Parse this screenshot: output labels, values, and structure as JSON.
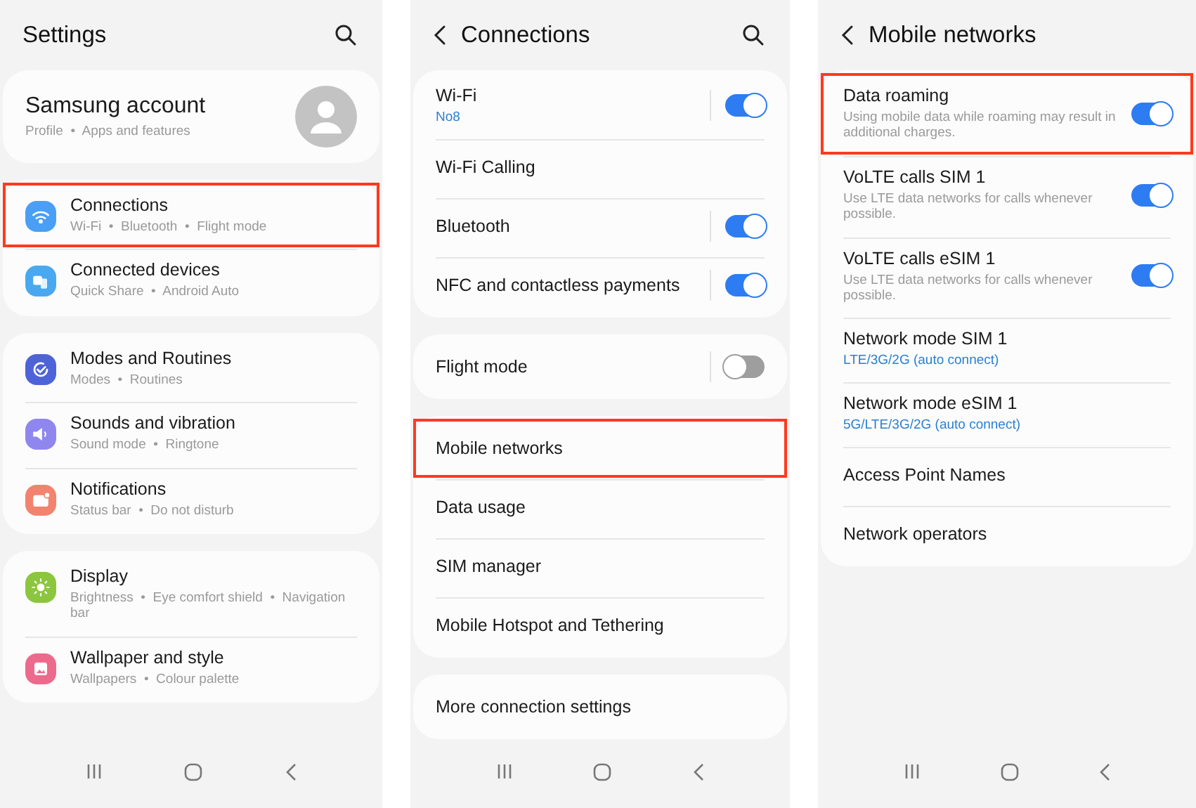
{
  "screens": [
    {
      "title": "Settings",
      "back_button": false,
      "search_button": true,
      "groups": [
        {
          "items": [
            {
              "kind": "account",
              "title": "Samsung account",
              "subtitle": "Profile  •  Apps and features",
              "highlighted": false
            }
          ]
        },
        {
          "items": [
            {
              "kind": "link",
              "title": "Connections",
              "subtitle": "Wi-Fi  •  Bluetooth  •  Flight mode",
              "color": "#4a9ff5",
              "highlighted": true
            },
            {
              "kind": "link",
              "title": "Connected devices",
              "subtitle": "Quick Share  •  Android Auto",
              "color": "#4aa8f0",
              "highlighted": false
            }
          ]
        },
        {
          "items": [
            {
              "kind": "link",
              "title": "Modes and Routines",
              "subtitle": "Modes  •  Routines",
              "color": "#4e63d8",
              "highlighted": false
            },
            {
              "kind": "link",
              "title": "Sounds and vibration",
              "subtitle": "Sound mode  •  Ringtone",
              "color": "#8f87ee",
              "highlighted": false
            },
            {
              "kind": "link",
              "title": "Notifications",
              "subtitle": "Status bar  •  Do not disturb",
              "color": "#f2836f",
              "highlighted": false
            }
          ]
        },
        {
          "items": [
            {
              "kind": "link",
              "title": "Display",
              "subtitle": "Brightness  •  Eye comfort shield  •  Navigation bar",
              "color": "#8cc63f",
              "highlighted": false
            },
            {
              "kind": "link",
              "title": "Wallpaper and style",
              "subtitle": "Wallpapers  •  Colour palette",
              "color": "#ec6b8d",
              "highlighted": false
            }
          ]
        }
      ]
    },
    {
      "title": "Connections",
      "back_button": true,
      "search_button": true,
      "groups": [
        {
          "items": [
            {
              "kind": "split_toggle",
              "title": "Wi-Fi",
              "value": "No8",
              "on": true,
              "highlighted": false
            },
            {
              "kind": "link",
              "title": "Wi-Fi Calling",
              "highlighted": false
            },
            {
              "kind": "split_toggle",
              "title": "Bluetooth",
              "on": true,
              "highlighted": false
            },
            {
              "kind": "split_toggle",
              "title": "NFC and contactless payments",
              "on": true,
              "highlighted": false
            }
          ]
        },
        {
          "items": [
            {
              "kind": "split_toggle",
              "title": "Flight mode",
              "on": false,
              "highlighted": false
            }
          ]
        },
        {
          "items": [
            {
              "kind": "link",
              "title": "Mobile networks",
              "highlighted": true
            },
            {
              "kind": "link",
              "title": "Data usage",
              "highlighted": false
            },
            {
              "kind": "link",
              "title": "SIM manager",
              "highlighted": false
            },
            {
              "kind": "link",
              "title": "Mobile Hotspot and Tethering",
              "highlighted": false
            }
          ]
        },
        {
          "items": [
            {
              "kind": "link",
              "title": "More connection settings",
              "highlighted": false
            }
          ]
        }
      ]
    },
    {
      "title": "Mobile networks",
      "back_button": true,
      "search_button": false,
      "groups": [
        {
          "items": [
            {
              "kind": "toggle",
              "title": "Data roaming",
              "subtitle": "Using mobile data while roaming may result in additional charges.",
              "on": true,
              "highlighted": true
            },
            {
              "kind": "toggle",
              "title": "VoLTE calls SIM 1",
              "subtitle": "Use LTE data networks for calls whenever possible.",
              "on": true,
              "highlighted": false
            },
            {
              "kind": "toggle",
              "title": "VoLTE calls eSIM 1",
              "subtitle": "Use LTE data networks for calls whenever possible.",
              "on": true,
              "highlighted": false
            },
            {
              "kind": "link",
              "title": "Network mode SIM 1",
              "value": "LTE/3G/2G (auto connect)",
              "highlighted": false
            },
            {
              "kind": "link",
              "title": "Network mode eSIM 1",
              "value": "5G/LTE/3G/2G (auto connect)",
              "highlighted": false
            },
            {
              "kind": "link",
              "title": "Access Point Names",
              "highlighted": false
            },
            {
              "kind": "link",
              "title": "Network operators",
              "highlighted": false
            }
          ]
        }
      ]
    }
  ]
}
